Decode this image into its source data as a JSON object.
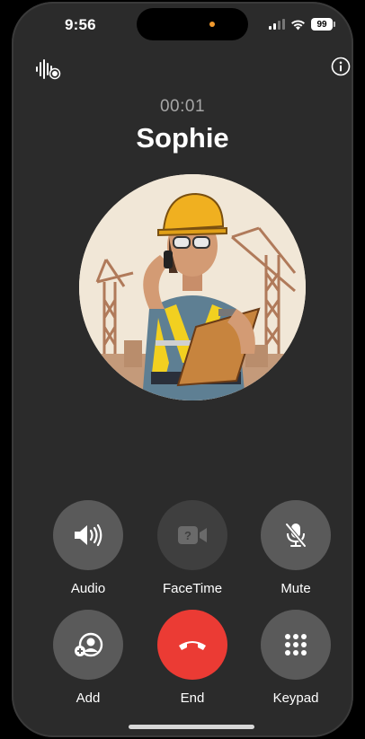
{
  "status_bar": {
    "time": "9:56",
    "battery": "99"
  },
  "call": {
    "timer": "00:01",
    "contact_name": "Sophie"
  },
  "controls": [
    {
      "label": "Audio",
      "icon": "speaker-icon"
    },
    {
      "label": "FaceTime",
      "icon": "facetime-video-icon"
    },
    {
      "label": "Mute",
      "icon": "mic-muted-icon"
    },
    {
      "label": "Add",
      "icon": "add-person-icon"
    },
    {
      "label": "End",
      "icon": "end-call-icon"
    },
    {
      "label": "Keypad",
      "icon": "keypad-icon"
    }
  ],
  "colors": {
    "end_button": "#eb3b34",
    "button_gray": "#5a5a5a",
    "background": "#2b2b2b"
  }
}
